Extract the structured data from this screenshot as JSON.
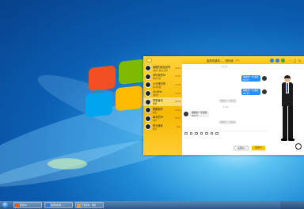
{
  "chat_window": {
    "title": "旋转的新林……阿你家",
    "title_badge": "(vip)",
    "minimize": "–",
    "maximize": "□",
    "close": "×",
    "contacts": [
      {
        "name": "隐藏的朋友我哥",
        "message": "[图片] 晚点说吧",
        "time": "14:23"
      },
      {
        "name": "你好我是Ta",
        "message": "你的消息",
        "time": "12:05"
      },
      {
        "name": "小马哥的哥",
        "message": "好的谢谢",
        "time": "11:40"
      },
      {
        "name": "(Sc)Bet",
        "message": "[图片]",
        "time": "11:02"
      },
      {
        "name": "思想者说",
        "message": "嗯嗯",
        "time": "10:18"
      },
      {
        "name": "刚刚新好",
        "message": "晚安",
        "time": "09:51"
      },
      {
        "name": "每天的Ta",
        "message": "哈哈",
        "time": "09:12"
      },
      {
        "name": "阳光我家",
        "message": "在吗",
        "time": "昨天"
      }
    ],
    "messages": [
      {
        "side": "me",
        "text": "播放的一条语音 00:27"
      },
      {
        "side": "me",
        "text": "播放的一条语音 00:35"
      },
      {
        "side": "them",
        "text": "播放的一条语音 00:17"
      }
    ],
    "timestamps": [
      "14:20",
      "14:22"
    ],
    "system_notes": [
      "你撤回了一条消息",
      "你撤回了一条消息"
    ],
    "close_button": "关闭(C)",
    "send_button": "发送(S)"
  },
  "taskbar": {
    "items": [
      {
        "label": "腾讯QQ",
        "color": "#e85a1b"
      },
      {
        "label": "旋转的新林……",
        "color": "#2f7be3"
      },
      {
        "label": "开始菜单 - 帮助",
        "color": "#e6a03a"
      }
    ]
  }
}
